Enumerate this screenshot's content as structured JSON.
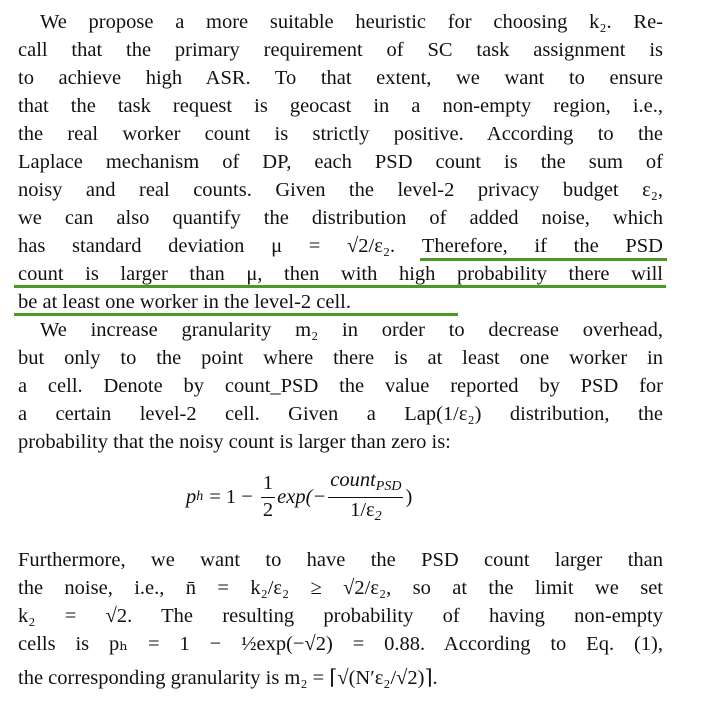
{
  "paragraph1": {
    "lines": [
      "We propose a more suitable heuristic for choosing k₂. Re-",
      "call that the primary requirement of SC task assignment is",
      "to achieve high ASR. To that extent, we want to ensure",
      "that the task request is geocast in a non-empty region, i.e.,",
      "the real worker count is strictly positive. According to the",
      "Laplace mechanism of DP, each PSD count is the sum of",
      "noisy and real counts. Given the level-2 privacy budget ε₂,",
      "we can also quantify the distribution of added noise, which",
      "has standard deviation μ = √2/ε₂. Therefore, if the PSD",
      "count is larger than μ, then with high probability there will",
      "be at least one worker in the level-2 cell."
    ]
  },
  "paragraph2": {
    "lines": [
      "We increase granularity m₂ in order to decrease overhead,",
      "but only to the point where there is at least one worker in",
      "a cell. Denote by count_PSD the value reported by PSD for",
      "a certain level-2 cell. Given a Lap(1/ε₂) distribution, the",
      "probability that the noisy count is larger than zero is:"
    ]
  },
  "equation": {
    "lhs": "p",
    "lhs_sub": "h",
    "eq": "= 1 −",
    "half_num": "1",
    "half_den": "2",
    "exp_open": "exp(−",
    "num_main": "count",
    "num_sub": "PSD",
    "den_main": "1/ε",
    "den_sub": "2",
    "exp_close": ")"
  },
  "paragraph3": {
    "lines": [
      "Furthermore, we want to have the PSD count larger than",
      "the noise, i.e., n̄ = k₂/ε₂ ≥ √2/ε₂, so at the limit we set",
      "k₂ = √2. The resulting probability of having non-empty",
      "cells is pₕ = 1 − ½exp(−√2) = 0.88. According to Eq. (1),",
      "the corresponding granularity is m₂ = ⌈√(N′ε₂/√2)⌉."
    ]
  }
}
